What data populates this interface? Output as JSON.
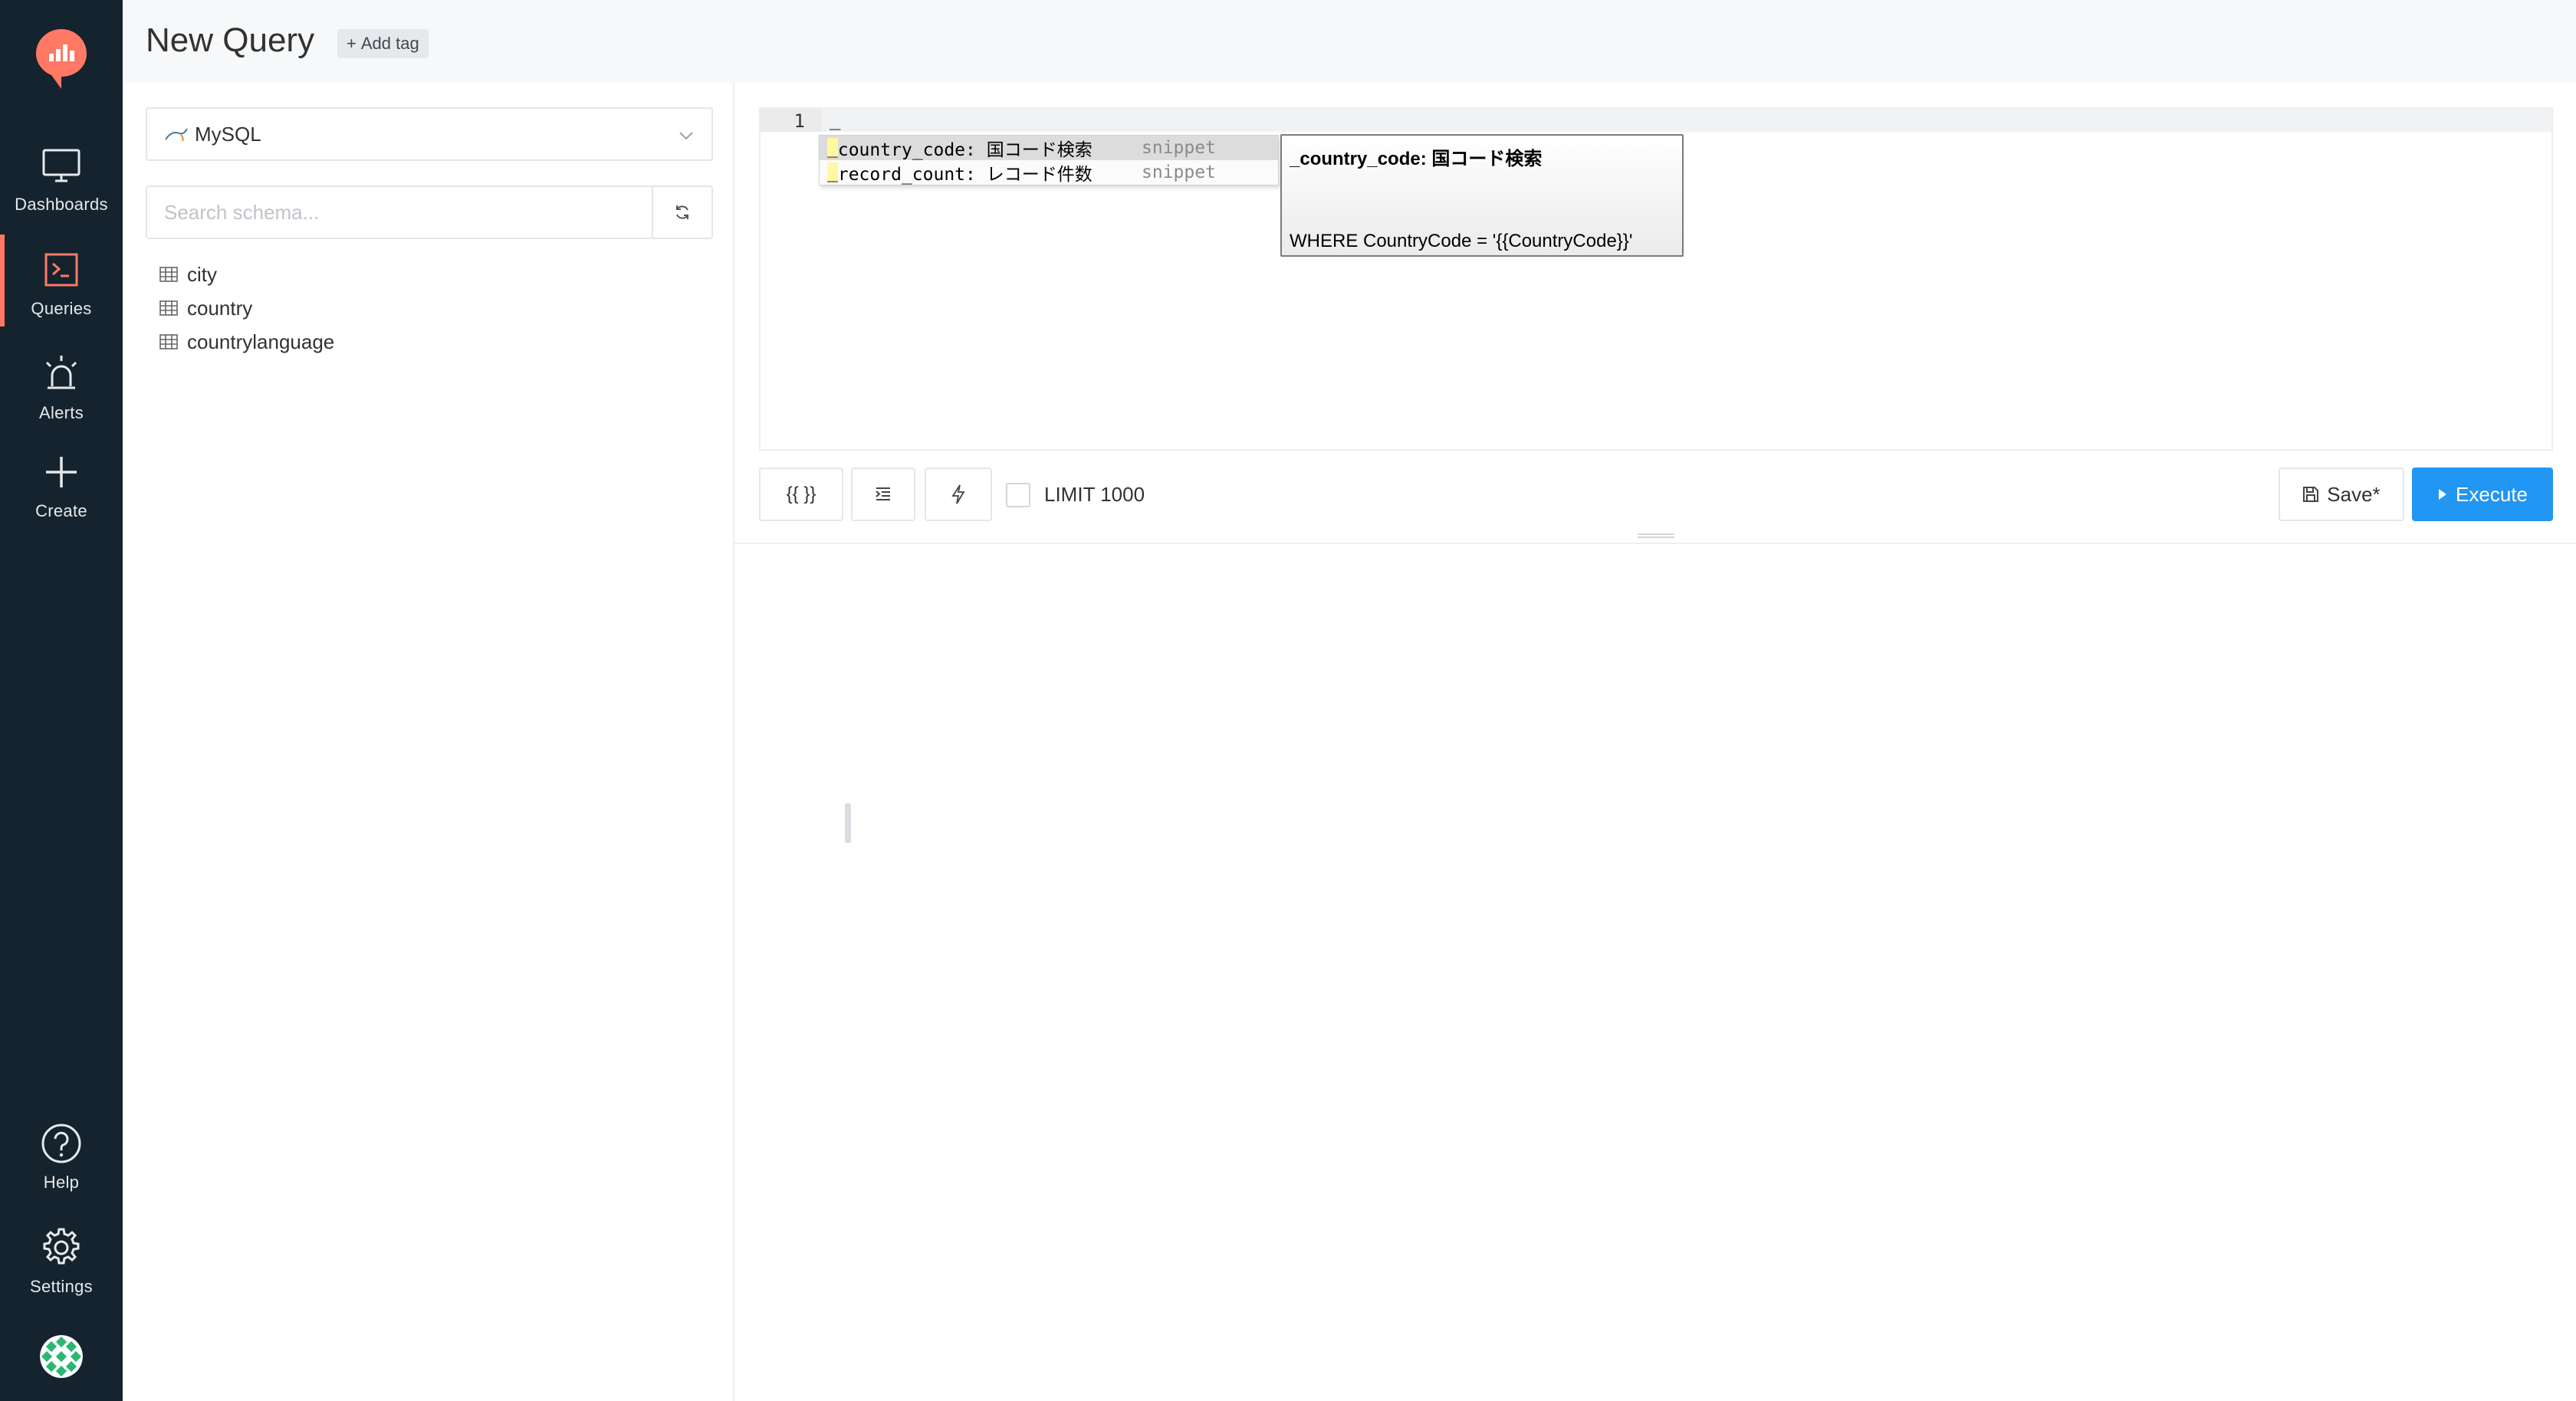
{
  "nav": {
    "items": [
      {
        "label": "Dashboards",
        "icon": "monitor-icon"
      },
      {
        "label": "Queries",
        "icon": "terminal-icon",
        "active": true
      },
      {
        "label": "Alerts",
        "icon": "alarm-icon"
      },
      {
        "label": "Create",
        "icon": "plus-icon"
      }
    ],
    "bottom": [
      {
        "label": "Help",
        "icon": "help-circle-icon"
      },
      {
        "label": "Settings",
        "icon": "gear-icon"
      }
    ],
    "colors": {
      "background": "#15232e",
      "accent": "#ff7964"
    }
  },
  "header": {
    "title": "New Query",
    "add_tag": "Add tag"
  },
  "schema": {
    "data_source": "MySQL",
    "search_placeholder": "Search schema...",
    "tables": [
      "city",
      "country",
      "countrylanguage"
    ]
  },
  "editor": {
    "line_number": "1",
    "code": "_",
    "autocomplete": [
      {
        "match": "_",
        "caption": "country_code: 国コード検索",
        "meta": "snippet"
      },
      {
        "match": "_",
        "caption": "record_count: レコード件数",
        "meta": "snippet"
      }
    ],
    "doc_tooltip": {
      "title": "_country_code: 国コード検索",
      "body": "WHERE CountryCode = '{{CountryCode}}'"
    }
  },
  "toolbar": {
    "params_label": "{{ }}",
    "limit_label": "LIMIT 1000",
    "limit_checked": false,
    "save_label": "Save*",
    "execute_label": "Execute",
    "execute_color": "#2196f3"
  }
}
